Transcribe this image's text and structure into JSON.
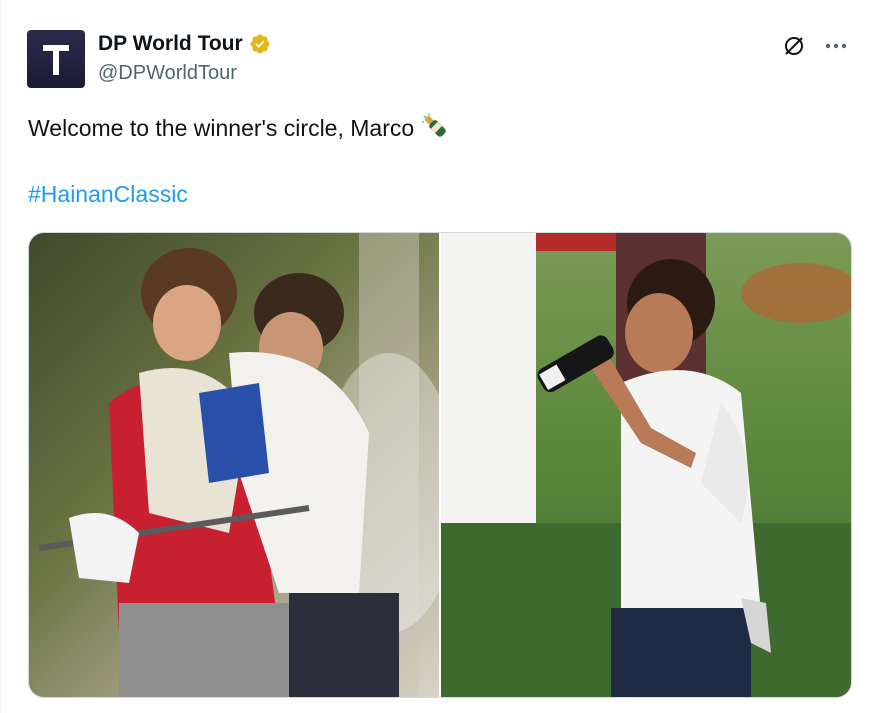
{
  "author": {
    "display_name": "DP World Tour",
    "handle": "@DPWorldTour",
    "verified": true,
    "avatar_icon": "dp-world-tour-t-logo"
  },
  "header_actions": [
    {
      "icon": "grok-icon"
    },
    {
      "icon": "more-icon"
    }
  ],
  "tweet": {
    "text": "Welcome to the winner's circle, Marco",
    "emoji": "champagne-bottle-emoji",
    "hashtag": "#HainanClassic"
  },
  "media": [
    {
      "alt": "caddie and golfer embracing while being sprayed with champagne"
    },
    {
      "alt": "golfer drinking from a champagne bottle"
    }
  ],
  "colors": {
    "link": "#1d9bf0",
    "text": "#0f1419",
    "secondary_text": "#536471",
    "verified_badge": "#e2b719",
    "border": "#cfd9de"
  }
}
